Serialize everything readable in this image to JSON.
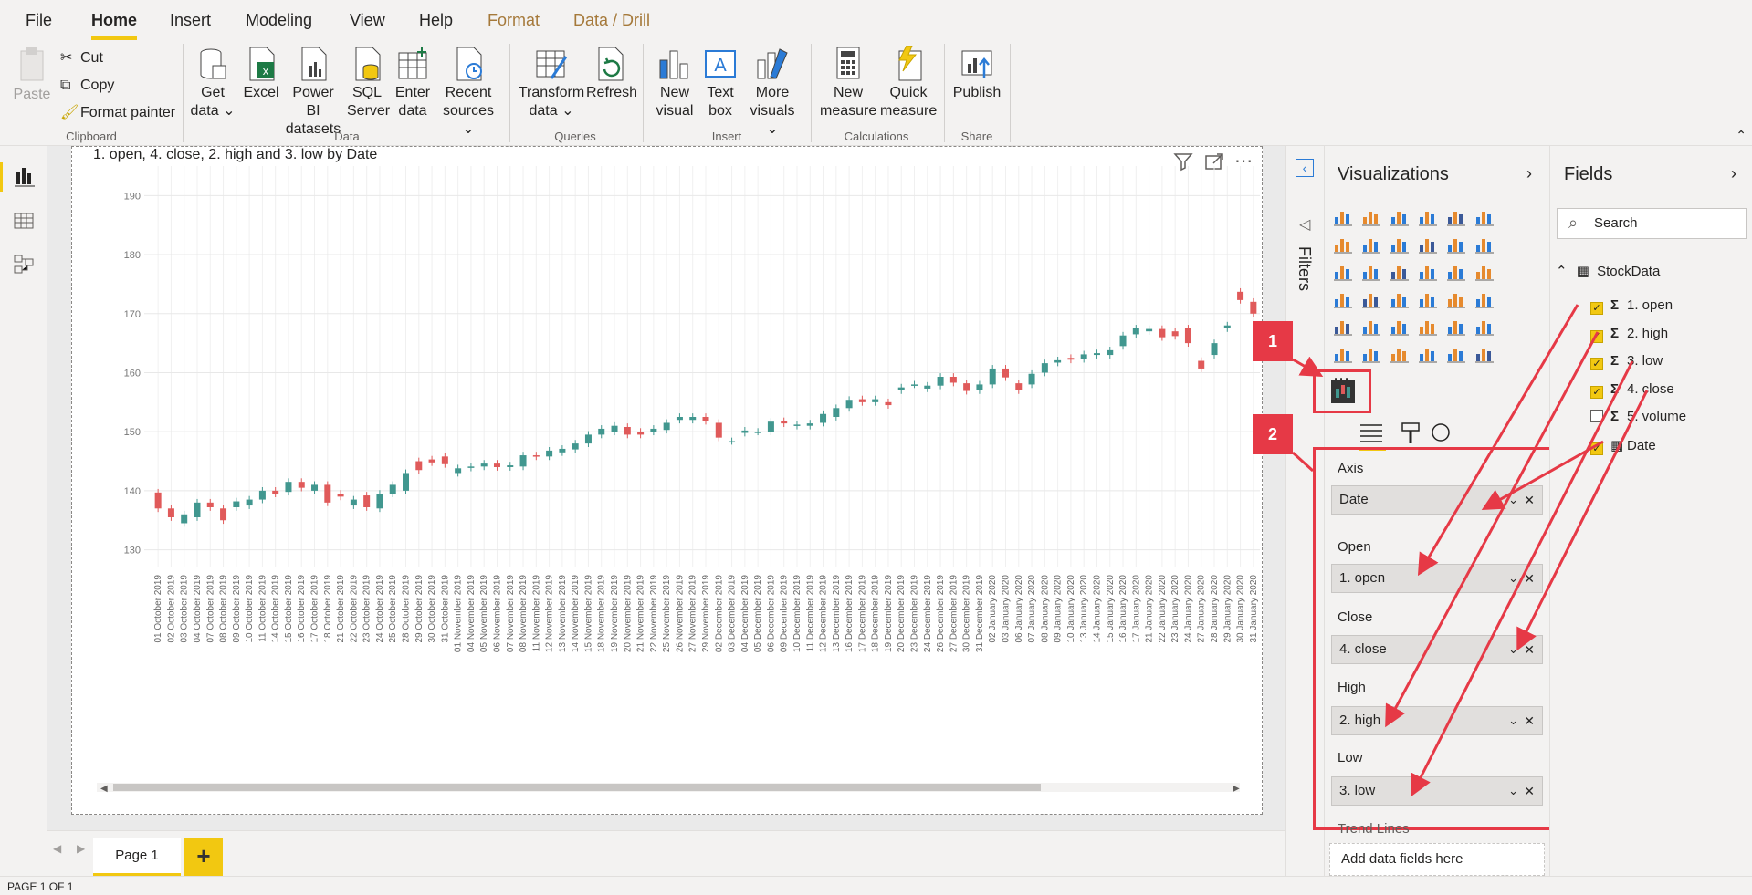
{
  "menu": {
    "tabs": [
      "File",
      "Home",
      "Insert",
      "Modeling",
      "View",
      "Help",
      "Format",
      "Data / Drill"
    ]
  },
  "ribbon": {
    "paste": "Paste",
    "cut": "Cut",
    "copy": "Copy",
    "format_painter": "Format painter",
    "get_data": [
      "Get",
      "data ⌄"
    ],
    "excel": "Excel",
    "pbi_datasets": [
      "Power BI",
      "datasets"
    ],
    "sql": [
      "SQL",
      "Server"
    ],
    "enter_data": [
      "Enter",
      "data"
    ],
    "recent": [
      "Recent",
      "sources ⌄"
    ],
    "transform": [
      "Transform",
      "data ⌄"
    ],
    "refresh": "Refresh",
    "new_visual": [
      "New",
      "visual"
    ],
    "text_box": [
      "Text",
      "box"
    ],
    "more_visuals": [
      "More",
      "visuals ⌄"
    ],
    "new_measure": [
      "New",
      "measure"
    ],
    "quick_measure": [
      "Quick",
      "measure"
    ],
    "publish": "Publish",
    "groups": [
      "Clipboard",
      "Data",
      "Queries",
      "Insert",
      "Calculations",
      "Share"
    ]
  },
  "visual": {
    "title": "1. open, 4. close, 2. high and 3. low by Date"
  },
  "chart_data": {
    "type": "candlestick",
    "title": "1. open, 4. close, 2. high and 3. low by Date",
    "ylim": [
      127,
      195
    ],
    "yticks": [
      130,
      140,
      150,
      160,
      170,
      180,
      190
    ],
    "x": [
      "01 October 2019",
      "02 October 2019",
      "03 October 2019",
      "04 October 2019",
      "07 October 2019",
      "08 October 2019",
      "09 October 2019",
      "10 October 2019",
      "11 October 2019",
      "14 October 2019",
      "15 October 2019",
      "16 October 2019",
      "17 October 2019",
      "18 October 2019",
      "21 October 2019",
      "22 October 2019",
      "23 October 2019",
      "24 October 2019",
      "25 October 2019",
      "28 October 2019",
      "29 October 2019",
      "30 October 2019",
      "31 October 2019",
      "01 November 2019",
      "04 November 2019",
      "05 November 2019",
      "06 November 2019",
      "07 November 2019",
      "08 November 2019",
      "11 November 2019",
      "12 November 2019",
      "13 November 2019",
      "14 November 2019",
      "15 November 2019",
      "18 November 2019",
      "19 November 2019",
      "20 November 2019",
      "21 November 2019",
      "22 November 2019",
      "25 November 2019",
      "26 November 2019",
      "27 November 2019",
      "29 November 2019",
      "02 December 2019",
      "03 December 2019",
      "04 December 2019",
      "05 December 2019",
      "06 December 2019",
      "09 December 2019",
      "10 December 2019",
      "11 December 2019",
      "12 December 2019",
      "13 December 2019",
      "16 December 2019",
      "17 December 2019",
      "18 December 2019",
      "19 December 2019",
      "20 December 2019",
      "23 December 2019",
      "24 December 2019",
      "26 December 2019",
      "27 December 2019",
      "30 December 2019",
      "31 December 2019",
      "02 January 2020",
      "03 January 2020",
      "06 January 2020",
      "07 January 2020",
      "08 January 2020",
      "09 January 2020",
      "10 January 2020",
      "13 January 2020",
      "14 January 2020",
      "15 January 2020",
      "16 January 2020",
      "17 January 2020",
      "21 January 2020",
      "22 January 2020",
      "23 January 2020",
      "24 January 2020",
      "27 January 2020",
      "28 January 2020",
      "29 January 2020",
      "30 January 2020",
      "31 January 2020"
    ],
    "open": [
      139.7,
      137,
      134.5,
      135.5,
      138,
      137,
      137.2,
      137.5,
      138.5,
      140,
      139.8,
      141.5,
      140,
      141,
      139.5,
      137.5,
      139.2,
      137,
      139.5,
      140,
      145,
      145.3,
      145.8,
      143,
      143.9,
      144.1,
      144.6,
      144,
      144.1,
      146,
      145.8,
      146.5,
      147,
      148,
      149.5,
      150,
      150.8,
      150,
      150,
      150.3,
      152,
      152,
      152.5,
      151.5,
      148.4,
      149.8,
      150,
      150,
      151.8,
      151,
      151,
      151.5,
      152.5,
      154,
      155.5,
      155,
      155,
      157,
      158,
      157.3,
      157.8,
      159.3,
      158.2,
      157,
      158,
      160.7,
      158.2,
      158,
      160,
      161.7,
      162.5,
      162.3,
      163,
      163,
      164.5,
      166.5,
      167,
      167.4,
      167,
      167.5,
      162,
      163,
      167.5,
      173.7,
      172
    ],
    "close": [
      137,
      135.5,
      136,
      138,
      137.2,
      135,
      138.2,
      138.5,
      140,
      139.5,
      141.5,
      140.5,
      141,
      138,
      139,
      138.5,
      137.2,
      139.5,
      141,
      143,
      143.5,
      144.8,
      144.5,
      143.8,
      144.1,
      144.6,
      144,
      144.3,
      146,
      145.8,
      146.8,
      147.1,
      148,
      149.5,
      150.5,
      151,
      149.5,
      149.5,
      150.5,
      151.5,
      152.5,
      152.5,
      151.8,
      149,
      148.4,
      150.2,
      150,
      151.7,
      151.4,
      151.2,
      151.4,
      153,
      154,
      155.4,
      155,
      155.5,
      154.5,
      157.5,
      158,
      157.8,
      159.3,
      158.3,
      156.9,
      158,
      160.7,
      159.2,
      157,
      159.8,
      161.6,
      162.1,
      162.2,
      163.1,
      163.3,
      163.8,
      166.3,
      167.5,
      167.4,
      166,
      166.2,
      165,
      160.7,
      165,
      168,
      172.3,
      170
    ]
  },
  "tabs": {
    "page1": "Page 1",
    "add": "+"
  },
  "status": "PAGE 1 OF 1",
  "filters": {
    "label": "Filters"
  },
  "viz": {
    "title": "Visualizations",
    "wells": [
      {
        "label": "Axis",
        "value": "Date"
      },
      {
        "label": "Open",
        "value": "1. open"
      },
      {
        "label": "Close",
        "value": "4. close"
      },
      {
        "label": "High",
        "value": "2. high"
      },
      {
        "label": "Low",
        "value": "3. low"
      }
    ],
    "trend": "Trend Lines",
    "add_fields": "Add data fields here"
  },
  "fields": {
    "title": "Fields",
    "search_placeholder": "Search",
    "table": "StockData",
    "items": [
      {
        "name": "1. open",
        "checked": true
      },
      {
        "name": "2. high",
        "checked": true
      },
      {
        "name": "3. low",
        "checked": true
      },
      {
        "name": "4. close",
        "checked": true
      },
      {
        "name": "5. volume",
        "checked": false
      },
      {
        "name": "Date",
        "checked": true
      }
    ]
  },
  "annotations": {
    "a1": "1",
    "a2": "2"
  },
  "colors": {
    "accent": "#f2c811",
    "up": "#41978f",
    "down": "#e05a5a",
    "annot": "#e63946"
  }
}
